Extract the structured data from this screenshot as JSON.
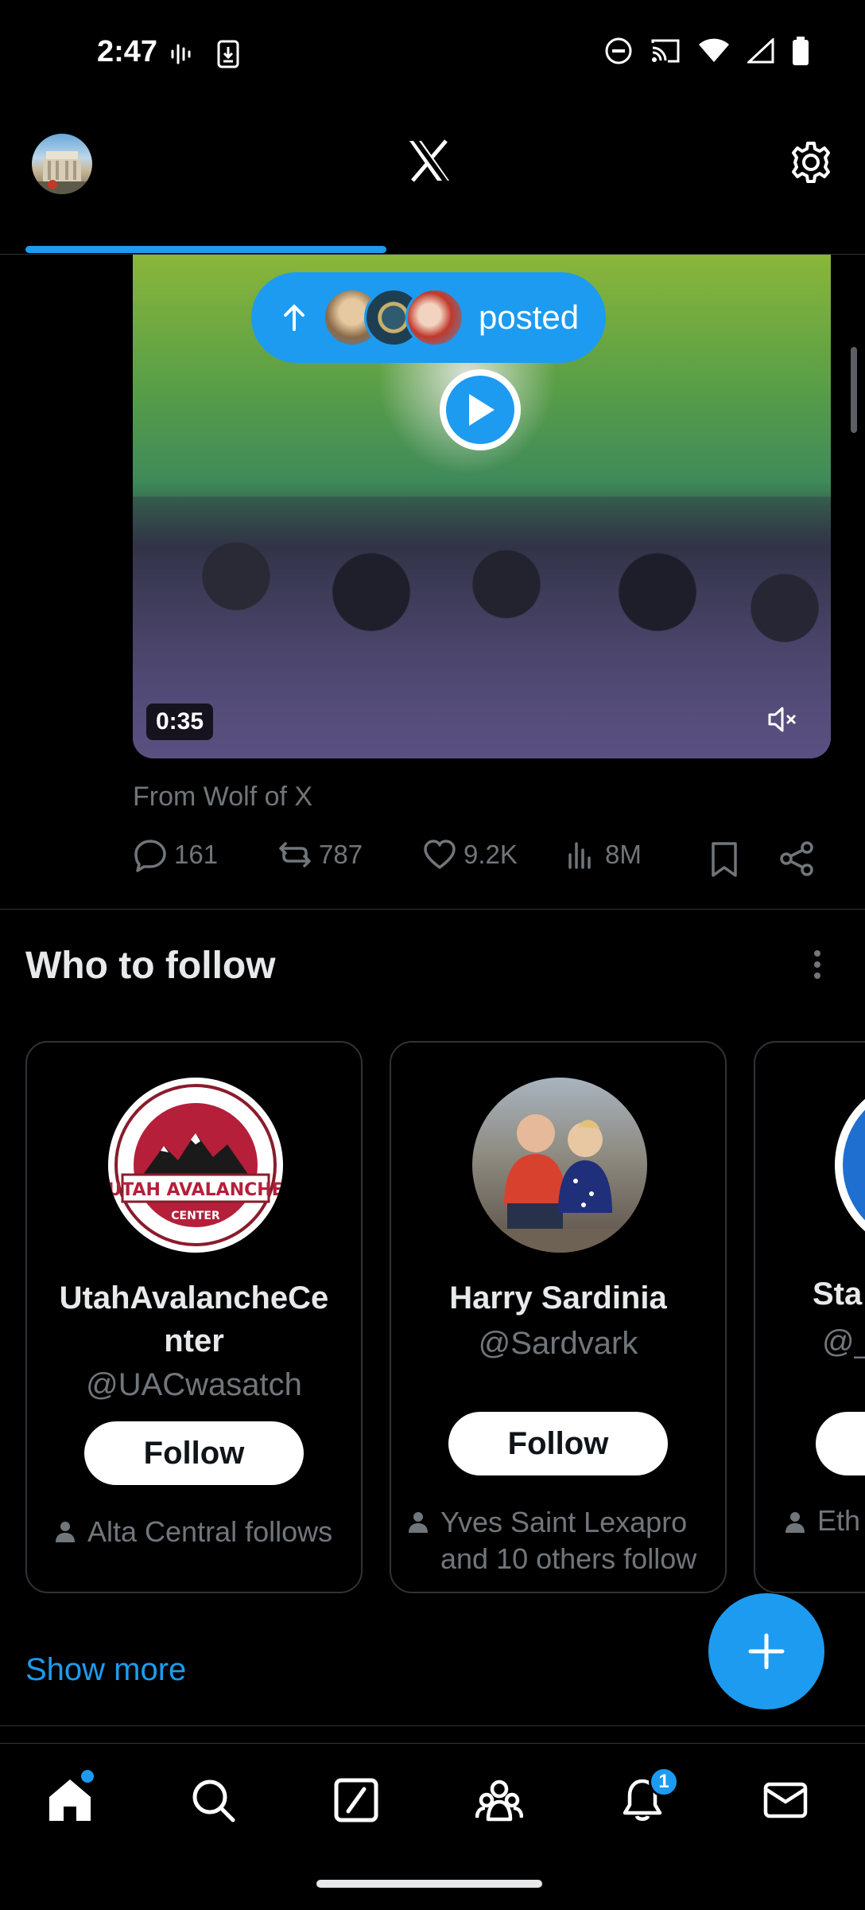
{
  "status_bar": {
    "time": "2:47"
  },
  "video": {
    "duration": "0:35",
    "posted_pill_label": "posted",
    "source": "From Wolf of X"
  },
  "actions": {
    "replies": "161",
    "reposts": "787",
    "likes": "9.2K",
    "views": "8M"
  },
  "who_to_follow": {
    "title": "Who to follow",
    "cards": [
      {
        "name": "UtahAvalancheCenter",
        "name_line1": "UtahAvalancheCe",
        "name_line2": "nter",
        "handle": "@UACwasatch",
        "follow_label": "Follow",
        "social_context": "Alta Central follows",
        "logo_text": "UTAH AVALANCHE",
        "logo_subtext": "CENTER"
      },
      {
        "name": "Harry Sardinia",
        "handle": "@Sardvark",
        "follow_label": "Follow",
        "social_context_line1": "Yves Saint Lexapro",
        "social_context_line2": "and 10 others follow"
      },
      {
        "name_partial": "Sta",
        "handle_partial": "@_",
        "social_context_partial": "Eth"
      }
    ],
    "show_more": "Show more"
  },
  "bottom_nav": {
    "notification_count": "1"
  },
  "colors": {
    "accent": "#1d9bf0",
    "background": "#000000",
    "muted": "#71767b",
    "text": "#e7e9ea"
  }
}
